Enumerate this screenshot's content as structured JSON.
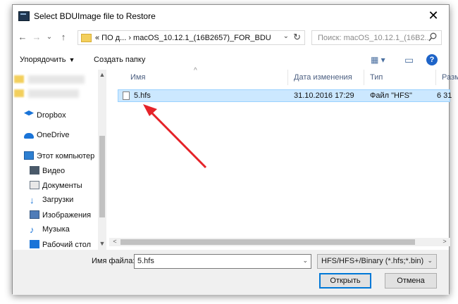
{
  "window": {
    "title": "Select BDUImage file to Restore",
    "close_glyph": "✕"
  },
  "address": {
    "back": "←",
    "forward": "→",
    "dropdown": "⌄",
    "up": "↑",
    "path": "« ПО д... › macOS_10.12.1_(16B2657)_FOR_BDU",
    "path_dd": "⌄",
    "refresh": "↻"
  },
  "search": {
    "placeholder": "Поиск: macOS_10.12.1_(16B2...",
    "icon": "search-icon"
  },
  "toolbar": {
    "organize": "Упорядочить",
    "new_folder": "Создать папку",
    "view_glyph": "▦ ▾",
    "pane_glyph": "▭",
    "help": "?"
  },
  "nav": {
    "items": [
      {
        "label": "Dropbox",
        "icon": "dropbox-icon",
        "color": "#1a74d8"
      },
      {
        "label": "OneDrive",
        "icon": "onedrive-icon",
        "color": "#1a74d8"
      },
      {
        "label": "Этот компьютер",
        "icon": "computer-icon",
        "color": "#2d7fd1"
      },
      {
        "label": "Видео",
        "icon": "video-icon",
        "color": "#4a5a6a"
      },
      {
        "label": "Документы",
        "icon": "documents-icon",
        "color": "#6d7a88"
      },
      {
        "label": "Загрузки",
        "icon": "downloads-icon",
        "color": "#1a74d8"
      },
      {
        "label": "Изображения",
        "icon": "pictures-icon",
        "color": "#4f7cb8"
      },
      {
        "label": "Музыка",
        "icon": "music-icon",
        "color": "#1a74d8"
      },
      {
        "label": "Рабочий стол",
        "icon": "desktop-icon",
        "color": "#1a74d8"
      }
    ],
    "scroll_up": "▲",
    "scroll_down": "▼"
  },
  "list": {
    "columns": [
      "Имя",
      "Дата изменения",
      "Тип",
      "Разм"
    ],
    "sort_caret": "^",
    "rows": [
      {
        "name": "5.hfs",
        "date": "31.10.2016 17:29",
        "type": "Файл \"HFS\"",
        "size": "6 31"
      }
    ],
    "hscroll_left": "<",
    "hscroll_right": ">"
  },
  "footer": {
    "filename_label": "Имя файла:",
    "filename_value": "5.hfs",
    "filter_value": "HFS/HFS+/Binary (*.hfs;*.bin)",
    "dd": "⌄",
    "open": "Открыть",
    "cancel": "Отмена"
  },
  "annotation": {
    "arrow_color": "#e52329"
  }
}
